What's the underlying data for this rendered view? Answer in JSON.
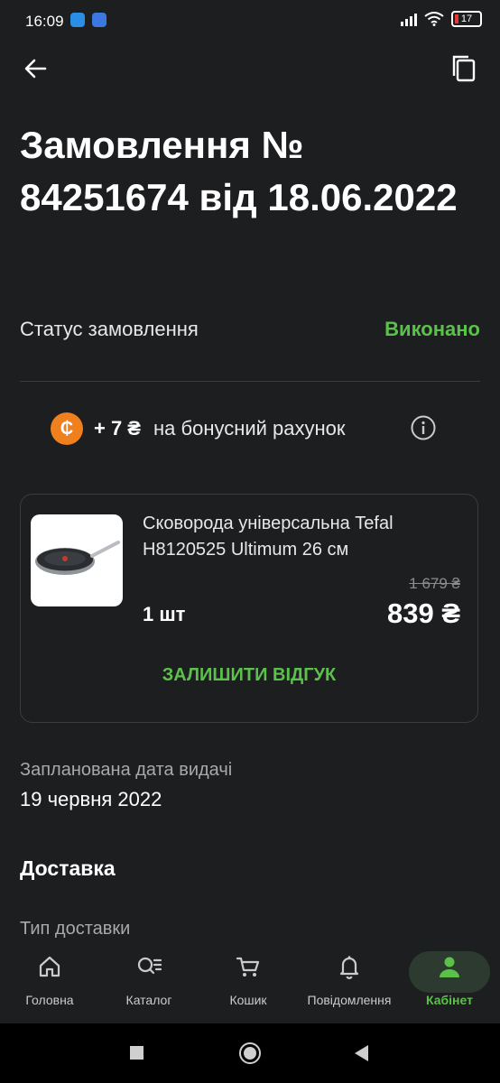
{
  "status_bar": {
    "time": "16:09",
    "battery": "17"
  },
  "header": {
    "title": "Замовлення № 84251674 від 18.06.2022"
  },
  "order_status": {
    "label": "Статус замовлення",
    "value": "Виконано"
  },
  "bonus": {
    "coin_symbol": "₵",
    "amount": "+ 7 ₴",
    "text": "на бонусний рахунок"
  },
  "product": {
    "name": "Сковорода універсальна Tefal H8120525 Ultimum 26 см",
    "old_price": "1 679 ₴",
    "price": "839 ₴",
    "quantity": "1 шт",
    "review_button": "ЗАЛИШИТИ ВІДГУК"
  },
  "pickup": {
    "label": "Запланована дата видачі",
    "value": "19 червня 2022"
  },
  "delivery": {
    "heading": "Доставка",
    "type_label": "Тип доставки"
  },
  "nav": {
    "items": [
      {
        "label": "Головна",
        "icon": "home-icon"
      },
      {
        "label": "Каталог",
        "icon": "catalog-search-icon"
      },
      {
        "label": "Кошик",
        "icon": "cart-icon"
      },
      {
        "label": "Повідомлення",
        "icon": "bell-icon"
      },
      {
        "label": "Кабінет",
        "icon": "user-icon"
      }
    ],
    "active_color": "#5cc14a"
  },
  "colors": {
    "background": "#1c1e20",
    "accent": "#5cc14a",
    "coin": "#f07f1e"
  }
}
